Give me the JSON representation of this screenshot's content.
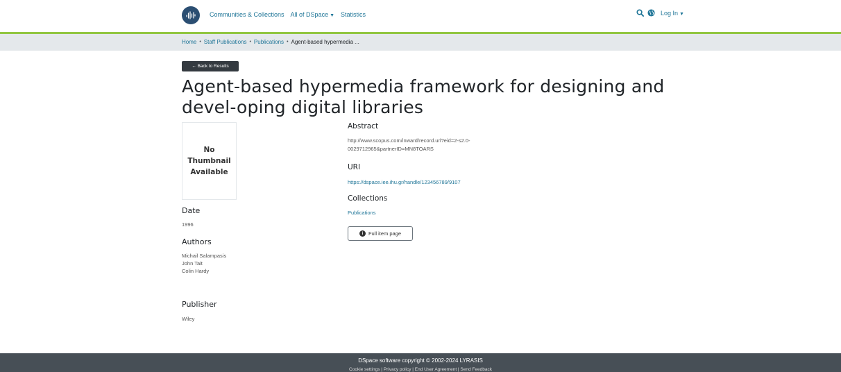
{
  "header": {
    "nav": [
      "Communities & Collections",
      "All of DSpace",
      "Statistics"
    ],
    "login": "Log In"
  },
  "breadcrumb": {
    "items": [
      "Home",
      "Staff Publications",
      "Publications"
    ],
    "current": "Agent-based hypermedia ..."
  },
  "back_label": "← Back to Results",
  "title": "Agent-based hypermedia framework for designing and devel-oping digital libraries",
  "thumbnail": [
    "No",
    "Thumbnail",
    "Available"
  ],
  "date": {
    "label": "Date",
    "value": "1996"
  },
  "authors": {
    "label": "Authors",
    "values": [
      "Michail Salampasis",
      "John Tait",
      "Colin Hardy"
    ]
  },
  "publisher": {
    "label": "Publisher",
    "value": "Wiley"
  },
  "abstract": {
    "label": "Abstract",
    "lines": [
      "http://www.scopus.com/inward/record.url?eid=2-s2.0-",
      "0029712965&partnerID=MN8TOARS"
    ]
  },
  "uri": {
    "label": "URI",
    "value": "https://dspace.iee.ihu.gr/handle/123456789/9107"
  },
  "collections": {
    "label": "Collections",
    "value": "Publications"
  },
  "full_item_label": "Full item page",
  "footer": {
    "copyright": "DSpace software copyright © 2002-2024 LYRASIS",
    "links": "Cookie settings | Privacy policy | End User Agreement | Send Feedback"
  }
}
